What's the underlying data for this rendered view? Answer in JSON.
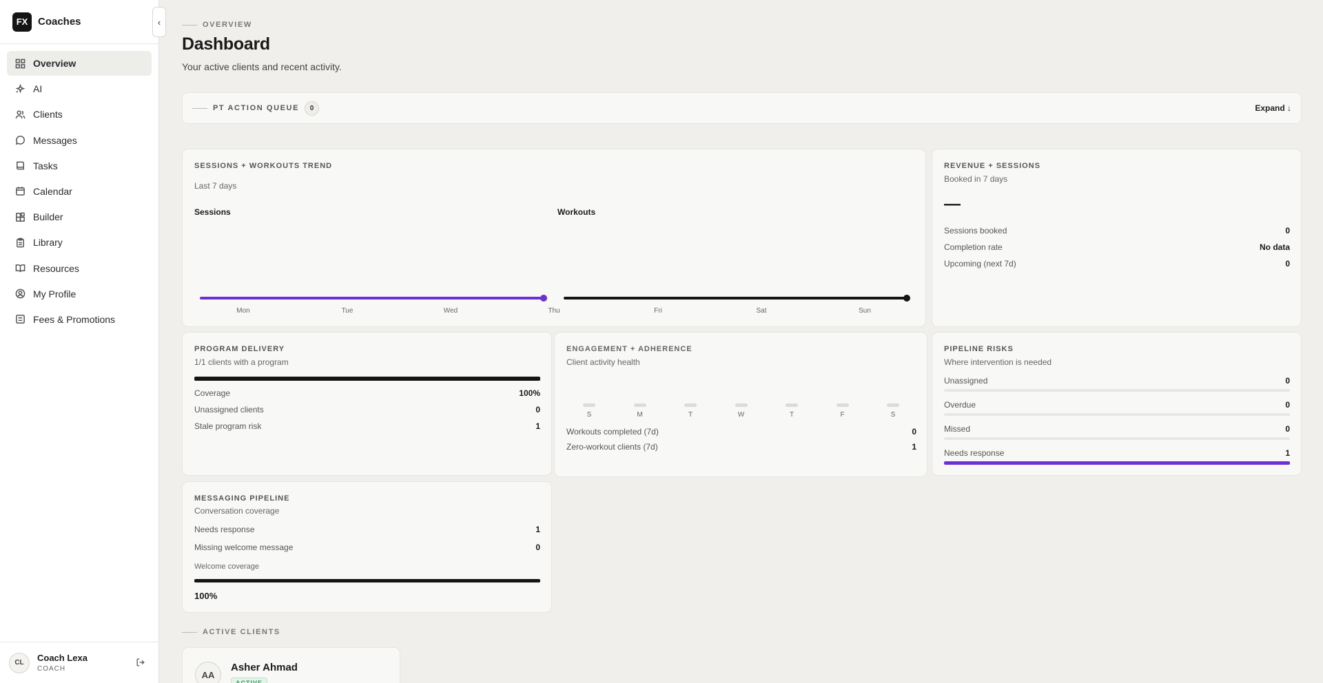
{
  "brand": {
    "logo": "FX",
    "name": "Coaches"
  },
  "sidebar": {
    "collapse_icon": "‹",
    "items": [
      {
        "label": "Overview",
        "icon": "grid-icon"
      },
      {
        "label": "AI",
        "icon": "sparkles-icon"
      },
      {
        "label": "Clients",
        "icon": "users-icon"
      },
      {
        "label": "Messages",
        "icon": "message-icon"
      },
      {
        "label": "Tasks",
        "icon": "book-icon"
      },
      {
        "label": "Calendar",
        "icon": "calendar-icon"
      },
      {
        "label": "Builder",
        "icon": "blocks-icon"
      },
      {
        "label": "Library",
        "icon": "clipboard-icon"
      },
      {
        "label": "Resources",
        "icon": "book-open-icon"
      },
      {
        "label": "My Profile",
        "icon": "user-circle-icon"
      },
      {
        "label": "Fees & Promotions",
        "icon": "list-icon"
      }
    ]
  },
  "user": {
    "initials": "CL",
    "name": "Coach Lexa",
    "role": "COACH"
  },
  "header": {
    "eyebrow": "OVERVIEW",
    "title": "Dashboard",
    "subtitle": "Your active clients and recent activity."
  },
  "queue": {
    "label": "PT ACTION QUEUE",
    "count": "0",
    "expand": "Expand ↓"
  },
  "trend": {
    "title": "SESSIONS + WORKOUTS TREND",
    "subtitle": "Last 7 days",
    "sessions_label": "Sessions",
    "workouts_label": "Workouts",
    "days": [
      "Mon",
      "Tue",
      "Wed",
      "Thu",
      "Fri",
      "Sat",
      "Sun"
    ]
  },
  "revenue": {
    "title": "REVENUE + SESSIONS",
    "subtitle": "Booked in 7 days",
    "value": "—",
    "rows": [
      {
        "label": "Sessions booked",
        "value": "0"
      },
      {
        "label": "Completion rate",
        "value": "No data"
      },
      {
        "label": "Upcoming (next 7d)",
        "value": "0"
      }
    ]
  },
  "program": {
    "title": "PROGRAM DELIVERY",
    "subtitle": "1/1 clients with a program",
    "progress": 1.0,
    "rows": [
      {
        "label": "Coverage",
        "value": "100%"
      },
      {
        "label": "Unassigned clients",
        "value": "0"
      },
      {
        "label": "Stale program risk",
        "value": "1"
      }
    ]
  },
  "engagement": {
    "title": "ENGAGEMENT + ADHERENCE",
    "subtitle": "Client activity health",
    "days": [
      "S",
      "M",
      "T",
      "W",
      "T",
      "F",
      "S"
    ],
    "rows": [
      {
        "label": "Workouts completed (7d)",
        "value": "0"
      },
      {
        "label": "Zero-workout clients (7d)",
        "value": "1"
      }
    ]
  },
  "risks": {
    "title": "PIPELINE RISKS",
    "subtitle": "Where intervention is needed",
    "rows": [
      {
        "label": "Unassigned",
        "value": "0",
        "fill": 0
      },
      {
        "label": "Overdue",
        "value": "0",
        "fill": 0
      },
      {
        "label": "Missed",
        "value": "0",
        "fill": 0
      },
      {
        "label": "Needs response",
        "value": "1",
        "fill": 1
      }
    ]
  },
  "messaging": {
    "title": "MESSAGING PIPELINE",
    "subtitle": "Conversation coverage",
    "rows": [
      {
        "label": "Needs response",
        "value": "1"
      },
      {
        "label": "Missing welcome message",
        "value": "0"
      }
    ],
    "coverage_label": "Welcome coverage",
    "coverage_value": "100%",
    "coverage_progress": 1.0
  },
  "clients": {
    "eyebrow": "ACTIVE CLIENTS",
    "items": [
      {
        "initials": "AA",
        "name": "Asher Ahmad",
        "status": "ACTIVE"
      }
    ]
  },
  "colors": {
    "accent": "#6d2fd6",
    "dark": "#141414"
  }
}
